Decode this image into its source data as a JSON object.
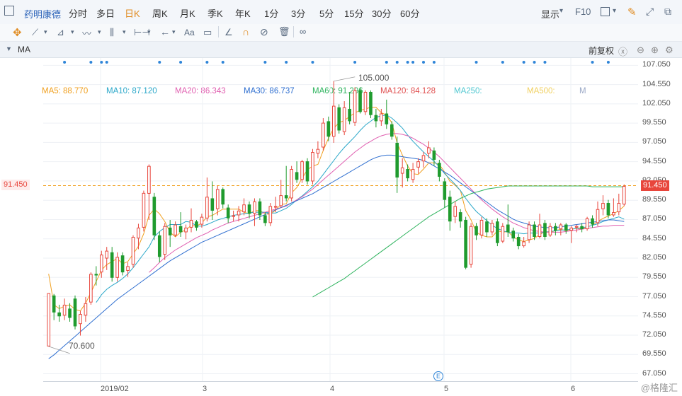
{
  "toolbar": {
    "stock_name": "药明康德",
    "periods": [
      {
        "label": "分时",
        "active": false
      },
      {
        "label": "多日",
        "active": false
      },
      {
        "label": "日K",
        "active": true
      },
      {
        "label": "周K",
        "active": false
      },
      {
        "label": "月K",
        "active": false
      },
      {
        "label": "季K",
        "active": false
      },
      {
        "label": "年K",
        "active": false
      },
      {
        "label": "1分",
        "active": false
      },
      {
        "label": "3分",
        "active": false
      },
      {
        "label": "5分",
        "active": false
      },
      {
        "label": "15分",
        "active": false
      },
      {
        "label": "30分",
        "active": false
      },
      {
        "label": "60分",
        "active": false
      }
    ],
    "display_label": "显示",
    "f10_label": "F10"
  },
  "drawing_tools": {
    "text_tool_label": "Aa",
    "icons": [
      "crosshair-icon",
      "line-icon",
      "ray-icon",
      "wave-icon",
      "channel-icon",
      "range-icon",
      "arrow-left-icon",
      "text-icon",
      "comment-icon",
      "ruler-icon",
      "magnet-icon",
      "hide-icon",
      "trash-icon",
      "glasses-icon"
    ]
  },
  "ma_bar": {
    "indicator": "MA",
    "items": [
      {
        "label": "MA5: 88.770",
        "color": "#f0a020"
      },
      {
        "label": "MA10: 87.120",
        "color": "#2aa7c9"
      },
      {
        "label": "MA20: 86.343",
        "color": "#e05fb0"
      },
      {
        "label": "MA30: 86.737",
        "color": "#2f6fd0"
      },
      {
        "label": "MA60: 91.296",
        "color": "#2db35d"
      },
      {
        "label": "MA120: 84.128",
        "color": "#e05050"
      },
      {
        "label": "MA250:",
        "color": "#4fc7d0"
      },
      {
        "label": "MA500:",
        "color": "#f0d060"
      },
      {
        "label": "M",
        "color": "#9aa8c6"
      }
    ],
    "adjust_label": "前复权"
  },
  "y_axis": {
    "ticks": [
      "107.050",
      "104.550",
      "102.050",
      "99.550",
      "97.050",
      "94.550",
      "92.050",
      "91.450",
      "89.550",
      "87.050",
      "84.550",
      "82.050",
      "79.550",
      "77.050",
      "74.550",
      "72.050",
      "69.550",
      "67.050"
    ],
    "current_price": "91.450"
  },
  "x_axis": {
    "labels": [
      "2019/02",
      "3",
      "4",
      "5",
      "6"
    ]
  },
  "annotations": {
    "high": "105.000",
    "low": "70.600",
    "event_marker": "E"
  },
  "watermark": "@格隆汇",
  "chart_data": {
    "type": "candlestick",
    "ylim": [
      66.0,
      108.0
    ],
    "y_ticks": [
      107.05,
      104.55,
      102.05,
      99.55,
      97.05,
      94.55,
      92.05,
      89.55,
      87.05,
      84.55,
      82.05,
      79.55,
      77.05,
      74.55,
      72.05,
      69.55,
      67.05
    ],
    "current_price": 91.45,
    "high_label": 105.0,
    "low_label": 70.6,
    "candles": [
      [
        70.6,
        77.5,
        70.6,
        77.2
      ],
      [
        77.2,
        75.0,
        74.0,
        77.4
      ],
      [
        75.0,
        74.5,
        73.8,
        76.0
      ],
      [
        74.6,
        76.0,
        74.0,
        76.8
      ],
      [
        75.5,
        74.3,
        73.8,
        76.2
      ],
      [
        76.8,
        73.2,
        72.8,
        77.2
      ],
      [
        73.5,
        74.8,
        72.0,
        75.2
      ],
      [
        74.6,
        76.2,
        73.8,
        77.0
      ],
      [
        76.3,
        80.0,
        76.0,
        80.2
      ],
      [
        80.0,
        79.8,
        78.5,
        81.0
      ],
      [
        80.2,
        82.5,
        79.5,
        83.0
      ],
      [
        82.0,
        83.0,
        80.5,
        83.5
      ],
      [
        82.8,
        79.5,
        79.0,
        83.5
      ],
      [
        79.5,
        82.2,
        79.0,
        82.8
      ],
      [
        82.4,
        80.2,
        79.8,
        82.8
      ],
      [
        80.4,
        81.0,
        79.6,
        81.5
      ],
      [
        81.2,
        84.8,
        80.8,
        85.0
      ],
      [
        84.6,
        86.0,
        83.2,
        86.5
      ],
      [
        86.0,
        90.5,
        85.5,
        90.8
      ],
      [
        90.4,
        94.0,
        87.0,
        94.2
      ],
      [
        90.0,
        85.0,
        84.4,
        90.5
      ],
      [
        85.0,
        82.2,
        81.5,
        85.5
      ],
      [
        82.5,
        86.2,
        81.8,
        86.6
      ],
      [
        86.0,
        85.0,
        83.5,
        87.0
      ],
      [
        85.0,
        86.4,
        84.8,
        86.8
      ],
      [
        86.2,
        85.4,
        84.8,
        88.0
      ],
      [
        85.4,
        86.0,
        84.5,
        86.4
      ],
      [
        86.0,
        87.0,
        85.4,
        88.5
      ],
      [
        86.8,
        86.0,
        85.6,
        87.0
      ],
      [
        86.4,
        87.4,
        86.0,
        87.8
      ],
      [
        87.2,
        90.0,
        86.8,
        92.5
      ],
      [
        89.8,
        88.2,
        87.0,
        92.0
      ],
      [
        88.4,
        91.0,
        87.6,
        91.4
      ],
      [
        91.0,
        89.0,
        88.5,
        91.2
      ],
      [
        88.6,
        87.2,
        86.6,
        89.0
      ],
      [
        87.4,
        87.6,
        86.8,
        88.2
      ],
      [
        87.6,
        88.2,
        86.8,
        88.8
      ],
      [
        88.0,
        89.0,
        87.6,
        89.8
      ],
      [
        89.0,
        87.8,
        87.2,
        89.4
      ],
      [
        87.8,
        89.4,
        86.2,
        89.8
      ],
      [
        89.4,
        87.6,
        87.0,
        89.8
      ],
      [
        87.6,
        86.6,
        86.2,
        88.0
      ],
      [
        86.6,
        88.8,
        86.2,
        89.2
      ],
      [
        88.6,
        88.8,
        88.0,
        90.0
      ],
      [
        88.8,
        90.2,
        88.6,
        92.2
      ],
      [
        90.2,
        89.8,
        89.4,
        94.0
      ],
      [
        89.8,
        93.6,
        89.4,
        94.0
      ],
      [
        93.2,
        92.2,
        91.8,
        94.6
      ],
      [
        92.2,
        94.6,
        91.8,
        94.8
      ],
      [
        94.6,
        92.0,
        91.6,
        95.0
      ],
      [
        92.0,
        95.8,
        91.6,
        96.2
      ],
      [
        95.6,
        96.2,
        95.0,
        97.2
      ],
      [
        96.4,
        99.6,
        96.0,
        100.2
      ],
      [
        99.8,
        97.8,
        97.2,
        100.4
      ],
      [
        97.8,
        101.8,
        97.0,
        105.0
      ],
      [
        101.6,
        98.6,
        98.2,
        102.0
      ],
      [
        98.4,
        101.6,
        98.0,
        102.4
      ],
      [
        101.4,
        99.8,
        99.4,
        103.6
      ],
      [
        99.6,
        103.8,
        99.2,
        104.2
      ],
      [
        103.8,
        101.0,
        100.8,
        104.2
      ],
      [
        101.0,
        103.6,
        100.6,
        103.8
      ],
      [
        103.6,
        100.6,
        100.2,
        103.8
      ],
      [
        100.6,
        99.8,
        99.0,
        101.4
      ],
      [
        99.8,
        100.8,
        99.2,
        101.4
      ],
      [
        100.8,
        99.4,
        98.8,
        102.6
      ],
      [
        99.4,
        97.8,
        97.4,
        99.8
      ],
      [
        97.0,
        92.5,
        90.5,
        97.8
      ],
      [
        93.0,
        93.8,
        91.2,
        95.0
      ],
      [
        93.6,
        92.4,
        92.0,
        94.2
      ],
      [
        92.2,
        93.6,
        91.8,
        94.4
      ],
      [
        93.8,
        94.6,
        93.0,
        95.0
      ],
      [
        94.6,
        95.4,
        93.8,
        95.8
      ],
      [
        95.6,
        96.4,
        95.0,
        97.2
      ],
      [
        96.0,
        94.8,
        94.0,
        96.4
      ],
      [
        94.4,
        92.6,
        92.0,
        94.8
      ],
      [
        92.0,
        89.6,
        88.6,
        92.4
      ],
      [
        90.0,
        86.8,
        85.6,
        90.8
      ],
      [
        87.4,
        88.8,
        86.6,
        89.4
      ],
      [
        88.0,
        86.8,
        86.0,
        88.4
      ],
      [
        87.0,
        80.8,
        80.6,
        87.4
      ],
      [
        81.2,
        86.2,
        80.8,
        86.6
      ],
      [
        86.2,
        85.0,
        84.4,
        86.6
      ],
      [
        85.0,
        87.0,
        84.6,
        87.4
      ],
      [
        86.8,
        85.4,
        84.8,
        87.2
      ],
      [
        85.4,
        86.6,
        85.0,
        87.0
      ],
      [
        86.8,
        84.0,
        83.6,
        87.2
      ],
      [
        84.2,
        86.2,
        84.0,
        86.6
      ],
      [
        86.4,
        85.4,
        84.8,
        89.0
      ],
      [
        85.6,
        84.6,
        84.2,
        86.0
      ],
      [
        84.8,
        83.6,
        83.2,
        85.2
      ],
      [
        83.6,
        84.2,
        83.4,
        84.8
      ],
      [
        84.4,
        86.4,
        84.0,
        86.8
      ],
      [
        86.4,
        84.8,
        84.4,
        86.8
      ],
      [
        84.8,
        86.4,
        84.6,
        87.8
      ],
      [
        86.6,
        84.8,
        84.4,
        87.0
      ],
      [
        85.0,
        86.2,
        84.8,
        86.6
      ],
      [
        86.2,
        85.6,
        85.0,
        86.6
      ],
      [
        85.8,
        86.4,
        85.0,
        86.6
      ],
      [
        86.4,
        85.6,
        85.2,
        86.6
      ],
      [
        85.6,
        86.0,
        84.0,
        86.2
      ],
      [
        86.0,
        86.2,
        85.4,
        86.4
      ],
      [
        86.2,
        85.8,
        85.4,
        86.6
      ],
      [
        85.8,
        87.2,
        85.6,
        87.4
      ],
      [
        87.2,
        86.4,
        86.0,
        87.6
      ],
      [
        86.6,
        88.4,
        86.2,
        89.4
      ],
      [
        88.4,
        89.2,
        87.6,
        90.2
      ],
      [
        89.2,
        87.6,
        87.2,
        89.6
      ],
      [
        87.6,
        88.0,
        87.4,
        89.8
      ],
      [
        88.0,
        89.2,
        87.6,
        90.4
      ],
      [
        89.0,
        91.4,
        88.8,
        91.6
      ]
    ],
    "ma_series": {
      "MA5": [
        80.0,
        76.0,
        75.5,
        75.8,
        76.0,
        75.4,
        75.2,
        76.2,
        77.6,
        79.0,
        80.5,
        81.2,
        81.6,
        82.0,
        81.3,
        81.6,
        82.6,
        83.6,
        85.2,
        87.6,
        88.4,
        87.8,
        86.8,
        85.4,
        84.8,
        85.4,
        85.7,
        86.3,
        86.2,
        86.6,
        87.4,
        87.6,
        88.0,
        88.4,
        88.4,
        88.4,
        88.4,
        88.0,
        87.8,
        88.2,
        88.2,
        87.8,
        87.7,
        88.3,
        89.0,
        89.1,
        90.5,
        91.2,
        92.4,
        93.5,
        94.0,
        94.2,
        96.0,
        97.6,
        98.9,
        99.6,
        99.9,
        100.4,
        100.9,
        101.2,
        101.4,
        101.6,
        101.6,
        100.9,
        100.6,
        99.6,
        97.0,
        95.4,
        94.0,
        93.0,
        92.9,
        93.6,
        94.4,
        94.4,
        94.2,
        93.2,
        92.0,
        91.5,
        90.8,
        88.2,
        87.0,
        85.4,
        85.0,
        84.8,
        84.8,
        85.6,
        85.4,
        85.5,
        84.8,
        84.4,
        84.2,
        84.4,
        84.6,
        85.1,
        85.5,
        85.4,
        85.6,
        85.8,
        85.6,
        85.8,
        85.9,
        85.8,
        86.1,
        86.3,
        86.8,
        87.2,
        87.5,
        87.8,
        88.2,
        88.8
      ],
      "MA10": [
        null,
        null,
        null,
        null,
        null,
        null,
        null,
        null,
        null,
        76.3,
        77.3,
        78.0,
        78.5,
        78.9,
        79.4,
        80.0,
        80.8,
        81.7,
        82.6,
        83.5,
        84.8,
        85.5,
        86.0,
        86.4,
        86.4,
        86.4,
        86.8,
        86.7,
        86.2,
        86.2,
        86.4,
        86.7,
        87.0,
        87.2,
        87.4,
        87.6,
        87.7,
        87.8,
        87.9,
        88.0,
        88.0,
        88.0,
        87.9,
        87.9,
        88.2,
        88.5,
        89.0,
        89.6,
        90.1,
        90.7,
        91.3,
        92.0,
        92.9,
        93.8,
        94.7,
        95.6,
        96.4,
        97.1,
        97.8,
        98.6,
        99.3,
        99.8,
        100.3,
        100.5,
        100.6,
        100.2,
        99.6,
        98.9,
        98.0,
        97.2,
        96.5,
        95.8,
        95.2,
        94.6,
        93.9,
        93.0,
        92.3,
        91.6,
        90.8,
        89.8,
        88.9,
        88.1,
        87.5,
        86.9,
        86.3,
        85.9,
        85.6,
        85.4,
        85.3,
        85.3,
        85.2,
        85.3,
        85.3,
        85.3,
        85.4,
        85.5,
        85.6,
        85.7,
        85.7,
        85.8,
        85.9,
        86.0,
        86.1,
        86.3,
        86.5,
        86.8,
        87.0,
        87.2,
        87.4,
        87.1
      ],
      "MA20": [
        null,
        null,
        null,
        null,
        null,
        null,
        null,
        null,
        null,
        null,
        null,
        null,
        null,
        null,
        null,
        null,
        null,
        null,
        null,
        80.2,
        80.8,
        81.5,
        82.1,
        82.6,
        83.1,
        83.5,
        83.9,
        84.3,
        84.7,
        85.0,
        85.3,
        85.7,
        86.0,
        86.3,
        86.6,
        86.8,
        87.0,
        87.2,
        87.4,
        87.6,
        87.8,
        88.0,
        88.2,
        88.4,
        88.6,
        88.8,
        89.2,
        89.6,
        90.0,
        90.5,
        91.0,
        91.6,
        92.2,
        92.8,
        93.4,
        94.0,
        94.6,
        95.2,
        95.8,
        96.3,
        96.8,
        97.2,
        97.6,
        97.9,
        98.1,
        98.2,
        98.2,
        98.1,
        97.9,
        97.6,
        97.2,
        96.8,
        96.3,
        95.8,
        95.2,
        94.5,
        93.8,
        93.1,
        92.4,
        91.7,
        91.0,
        90.3,
        89.6,
        89.0,
        88.4,
        87.9,
        87.4,
        87.0,
        86.6,
        86.3,
        86.0,
        85.8,
        85.6,
        85.5,
        85.4,
        85.4,
        85.4,
        85.4,
        85.5,
        85.6,
        85.7,
        85.8,
        85.9,
        86.0,
        86.1,
        86.2,
        86.2,
        86.3,
        86.3,
        86.3
      ],
      "MA30": [
        69.0,
        69.5,
        70.1,
        70.7,
        71.3,
        71.9,
        72.5,
        73.1,
        73.7,
        74.3,
        74.9,
        75.5,
        76.1,
        76.7,
        77.2,
        77.7,
        78.2,
        78.7,
        79.2,
        79.7,
        80.2,
        80.7,
        81.2,
        81.7,
        82.1,
        82.5,
        82.9,
        83.3,
        83.7,
        84.1,
        84.4,
        84.7,
        85.0,
        85.3,
        85.6,
        85.9,
        86.2,
        86.5,
        86.8,
        87.1,
        87.4,
        87.7,
        88.0,
        88.3,
        88.6,
        88.9,
        89.2,
        89.5,
        89.8,
        90.1,
        90.4,
        90.8,
        91.2,
        91.6,
        92.0,
        92.4,
        92.8,
        93.2,
        93.6,
        94.0,
        94.4,
        94.8,
        95.1,
        95.3,
        95.4,
        95.4,
        95.3,
        95.2,
        95.1,
        95.0,
        94.9,
        94.7,
        94.4,
        94.0,
        93.6,
        93.2,
        92.8,
        92.3,
        91.8,
        91.3,
        90.8,
        90.3,
        89.8,
        89.3,
        88.8,
        88.3,
        87.9,
        87.5,
        87.1,
        86.8,
        86.6,
        86.4,
        86.2,
        86.1,
        86.0,
        86.0,
        86.0,
        86.1,
        86.2,
        86.3,
        86.4,
        86.5,
        86.6,
        86.7,
        86.8,
        86.9,
        87.0,
        87.0,
        86.9,
        86.8
      ],
      "MA60": [
        null,
        null,
        null,
        null,
        null,
        null,
        null,
        null,
        null,
        null,
        null,
        null,
        null,
        null,
        null,
        null,
        null,
        null,
        null,
        null,
        null,
        null,
        null,
        null,
        null,
        null,
        null,
        null,
        null,
        null,
        null,
        null,
        null,
        null,
        null,
        null,
        null,
        null,
        null,
        null,
        null,
        null,
        null,
        null,
        null,
        null,
        null,
        null,
        null,
        null,
        77.0,
        77.4,
        77.8,
        78.2,
        78.6,
        79.0,
        79.4,
        79.9,
        80.4,
        80.9,
        81.4,
        81.9,
        82.4,
        82.9,
        83.4,
        83.9,
        84.4,
        84.9,
        85.4,
        85.9,
        86.4,
        86.9,
        87.4,
        87.8,
        88.2,
        88.6,
        89.0,
        89.4,
        89.8,
        90.1,
        90.4,
        90.6,
        90.8,
        91.0,
        91.1,
        91.2,
        91.3,
        91.4,
        91.4,
        91.4,
        91.4,
        91.4,
        91.4,
        91.4,
        91.4,
        91.4,
        91.4,
        91.4,
        91.4,
        91.4,
        91.4,
        91.4,
        91.4,
        91.3,
        91.3,
        91.3,
        91.3,
        91.3,
        91.3,
        91.3
      ]
    }
  }
}
